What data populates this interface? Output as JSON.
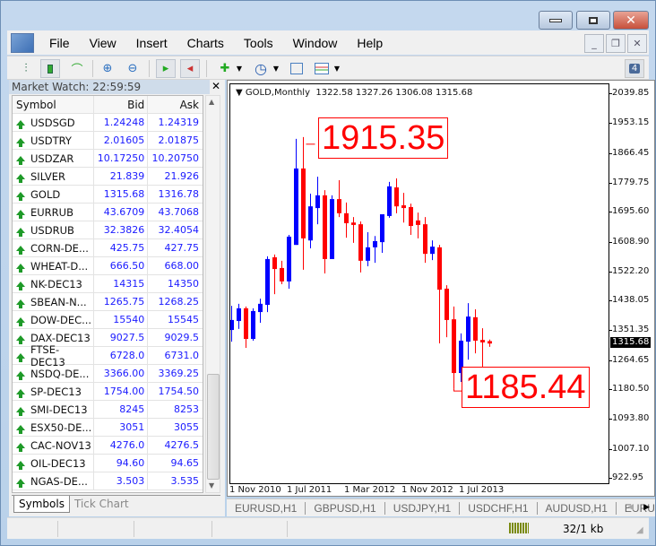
{
  "menu": {
    "items": [
      "File",
      "View",
      "Insert",
      "Charts",
      "Tools",
      "Window",
      "Help"
    ]
  },
  "toolbar": {
    "notifications_count": "4"
  },
  "market_watch": {
    "title": "Market Watch: 22:59:59",
    "columns": [
      "Symbol",
      "Bid",
      "Ask"
    ],
    "rows": [
      {
        "symbol": "USDSGD",
        "bid": "1.24248",
        "ask": "1.24319"
      },
      {
        "symbol": "USDTRY",
        "bid": "2.01605",
        "ask": "2.01875"
      },
      {
        "symbol": "USDZAR",
        "bid": "10.17250",
        "ask": "10.20750"
      },
      {
        "symbol": "SILVER",
        "bid": "21.839",
        "ask": "21.926"
      },
      {
        "symbol": "GOLD",
        "bid": "1315.68",
        "ask": "1316.78"
      },
      {
        "symbol": "EURRUB",
        "bid": "43.6709",
        "ask": "43.7068"
      },
      {
        "symbol": "USDRUB",
        "bid": "32.3826",
        "ask": "32.4054"
      },
      {
        "symbol": "CORN-DE...",
        "bid": "425.75",
        "ask": "427.75"
      },
      {
        "symbol": "WHEAT-D...",
        "bid": "666.50",
        "ask": "668.00"
      },
      {
        "symbol": "NK-DEC13",
        "bid": "14315",
        "ask": "14350"
      },
      {
        "symbol": "SBEAN-N...",
        "bid": "1265.75",
        "ask": "1268.25"
      },
      {
        "symbol": "DOW-DEC...",
        "bid": "15540",
        "ask": "15545"
      },
      {
        "symbol": "DAX-DEC13",
        "bid": "9027.5",
        "ask": "9029.5"
      },
      {
        "symbol": "FTSE-DEC13",
        "bid": "6728.0",
        "ask": "6731.0"
      },
      {
        "symbol": "NSDQ-DE...",
        "bid": "3366.00",
        "ask": "3369.25"
      },
      {
        "symbol": "SP-DEC13",
        "bid": "1754.00",
        "ask": "1754.50"
      },
      {
        "symbol": "SMI-DEC13",
        "bid": "8245",
        "ask": "8253"
      },
      {
        "symbol": "ESX50-DE...",
        "bid": "3051",
        "ask": "3055"
      },
      {
        "symbol": "CAC-NOV13",
        "bid": "4276.0",
        "ask": "4276.5"
      },
      {
        "symbol": "OIL-DEC13",
        "bid": "94.60",
        "ask": "94.65"
      },
      {
        "symbol": "NGAS-DE...",
        "bid": "3.503",
        "ask": "3.535"
      }
    ],
    "tabs": [
      "Symbols",
      "Tick Chart"
    ]
  },
  "chart": {
    "header": "GOLD,Monthly",
    "ohlc": "1322.58 1327.26 1306.08 1315.68",
    "high_label": "1915.35",
    "low_label": "1185.44",
    "current_price": "1315.68",
    "colors": {
      "bull": "#0000ff",
      "bear": "#ff0000"
    }
  },
  "chart_data": {
    "type": "candlestick",
    "title": "GOLD,Monthly",
    "ylim": [
      922.95,
      2039.85
    ],
    "ytick_labels": [
      "2039.85",
      "1953.15",
      "1866.45",
      "1779.75",
      "1695.60",
      "1608.90",
      "1522.20",
      "1438.05",
      "1351.35",
      "1264.65",
      "1180.50",
      "1093.80",
      "1007.10",
      "922.95"
    ],
    "xtick_labels": [
      "1 Nov 2010",
      "1 Jul 2011",
      "1 Mar 2012",
      "1 Nov 2012",
      "1 Jul 2013"
    ],
    "columns": [
      "date",
      "open",
      "high",
      "low",
      "close"
    ],
    "candles": [
      [
        "2010-11",
        1355,
        1425,
        1321,
        1384
      ],
      [
        "2010-12",
        1381,
        1431,
        1358,
        1418
      ],
      [
        "2011-01",
        1418,
        1423,
        1303,
        1329
      ],
      [
        "2011-02",
        1329,
        1418,
        1324,
        1410
      ],
      [
        "2011-03",
        1407,
        1446,
        1376,
        1431
      ],
      [
        "2011-04",
        1428,
        1569,
        1407,
        1561
      ],
      [
        "2011-05",
        1566,
        1574,
        1459,
        1532
      ],
      [
        "2011-06",
        1535,
        1556,
        1488,
        1496
      ],
      [
        "2011-07",
        1496,
        1631,
        1475,
        1626
      ],
      [
        "2011-08",
        1602,
        1910,
        1602,
        1824
      ],
      [
        "2011-09",
        1824,
        1915.35,
        1530,
        1621
      ],
      [
        "2011-10",
        1615,
        1751,
        1592,
        1714
      ],
      [
        "2011-11",
        1709,
        1800,
        1662,
        1746
      ],
      [
        "2011-12",
        1746,
        1761,
        1519,
        1561
      ],
      [
        "2012-01",
        1561,
        1746,
        1561,
        1735
      ],
      [
        "2012-02",
        1735,
        1790,
        1683,
        1694
      ],
      [
        "2012-03",
        1694,
        1725,
        1623,
        1665
      ],
      [
        "2012-04",
        1667,
        1683,
        1608,
        1660
      ],
      [
        "2012-05",
        1662,
        1670,
        1522,
        1556
      ],
      [
        "2012-06",
        1556,
        1639,
        1540,
        1595
      ],
      [
        "2012-07",
        1595,
        1628,
        1550,
        1613
      ],
      [
        "2012-08",
        1610,
        1691,
        1579,
        1691
      ],
      [
        "2012-09",
        1686,
        1785,
        1681,
        1772
      ],
      [
        "2012-10",
        1769,
        1795,
        1694,
        1714
      ],
      [
        "2012-11",
        1717,
        1753,
        1667,
        1709
      ],
      [
        "2012-12",
        1712,
        1722,
        1631,
        1657
      ],
      [
        "2013-01",
        1673,
        1696,
        1621,
        1660
      ],
      [
        "2013-02",
        1662,
        1683,
        1550,
        1576
      ],
      [
        "2013-03",
        1576,
        1615,
        1558,
        1597
      ],
      [
        "2013-04",
        1595,
        1602,
        1316,
        1472
      ],
      [
        "2013-05",
        1475,
        1485,
        1334,
        1384
      ],
      [
        "2013-06",
        1386,
        1423,
        1185.44,
        1230
      ],
      [
        "2013-07",
        1230,
        1345,
        1204,
        1324
      ],
      [
        "2013-08",
        1321,
        1433,
        1269,
        1394
      ],
      [
        "2013-09",
        1392,
        1415,
        1287,
        1324
      ],
      [
        "2013-10",
        1326,
        1360,
        1248,
        1319
      ],
      [
        "2013-11",
        1322.58,
        1327.26,
        1306.08,
        1315.68
      ]
    ]
  },
  "chart_tabs": [
    "EURUSD,H1",
    "GBPUSD,H1",
    "USDJPY,H1",
    "USDCHF,H1",
    "AUDUSD,H1",
    "EURU"
  ],
  "status": {
    "traffic": "32/1 kb"
  }
}
